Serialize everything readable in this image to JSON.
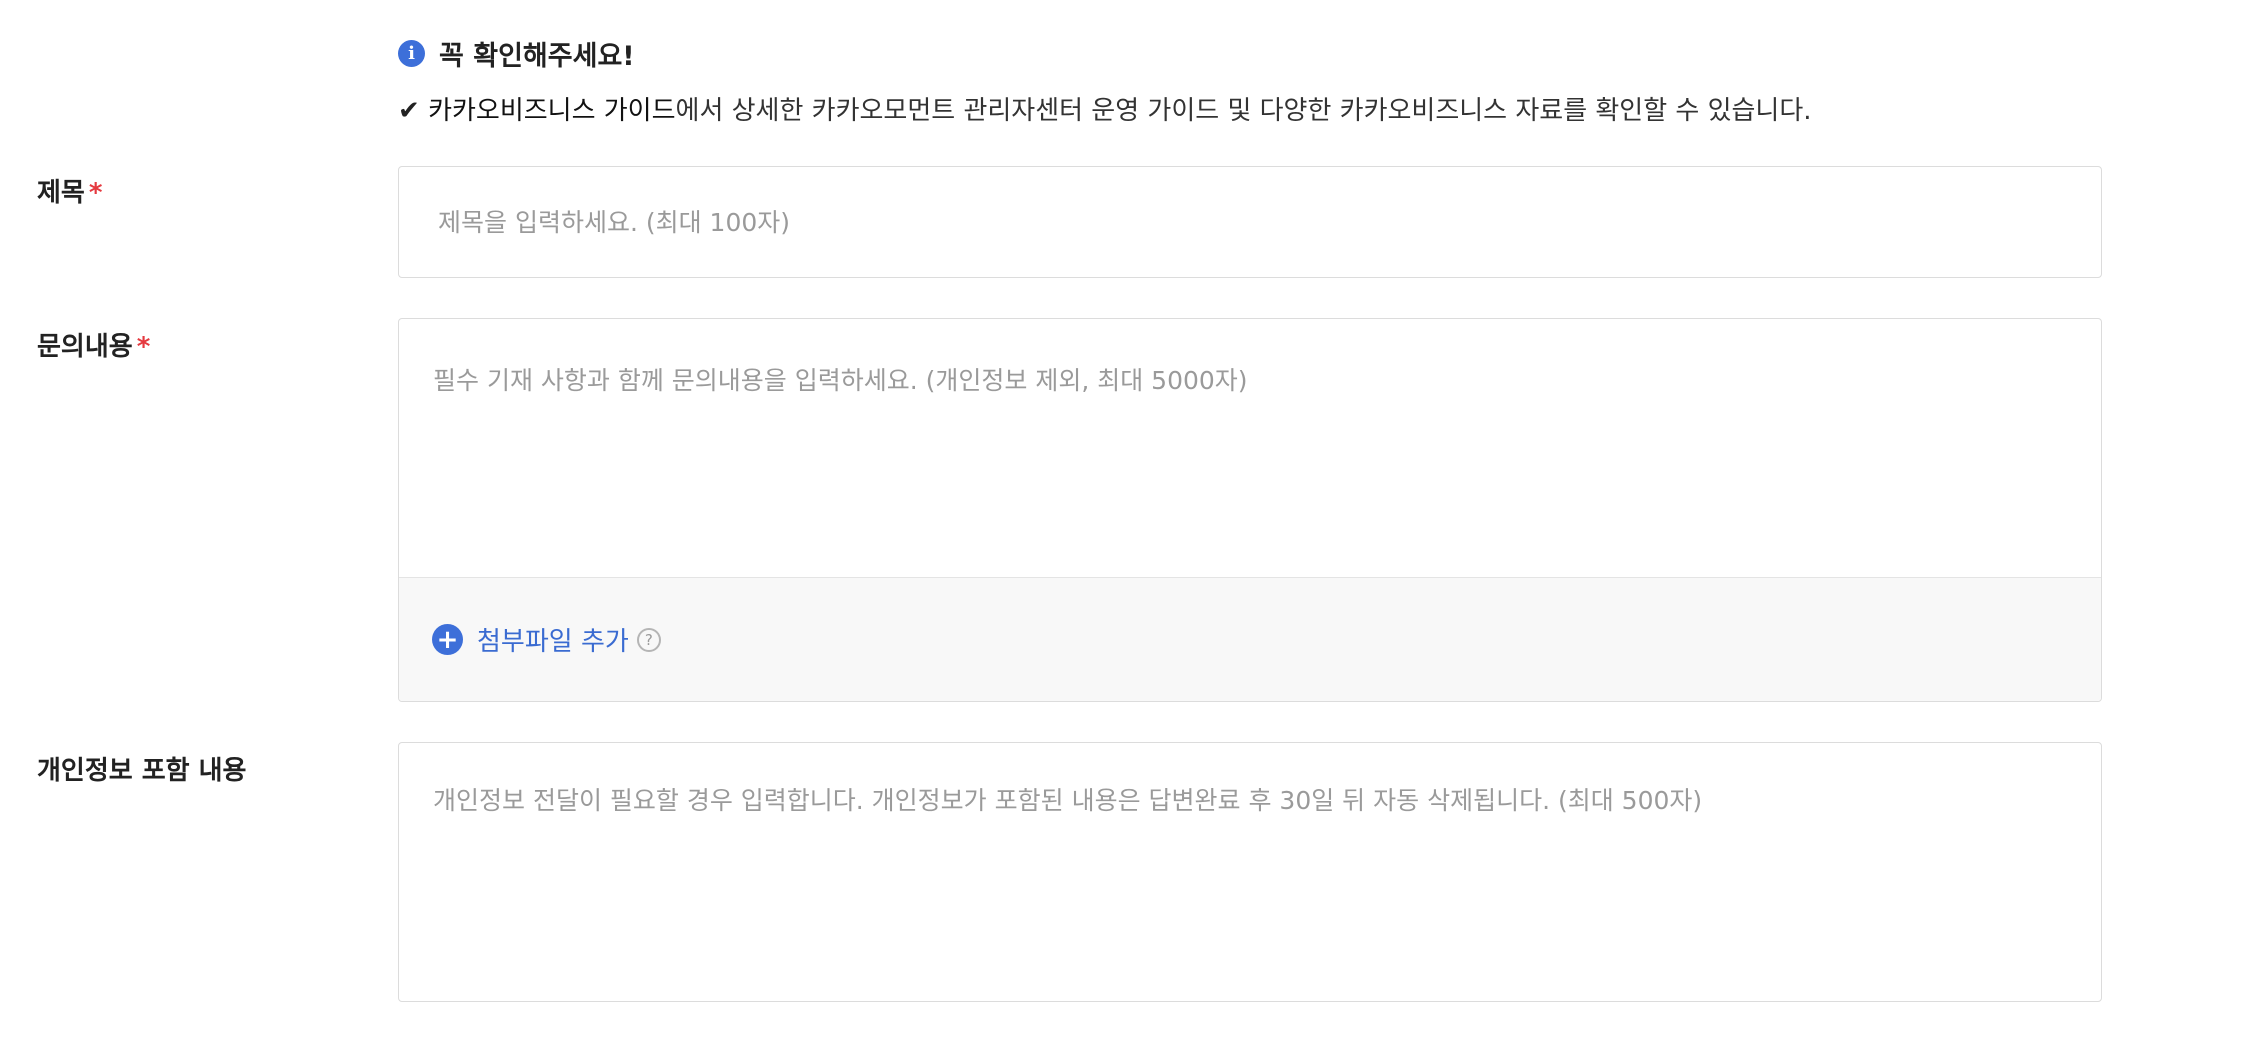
{
  "notice": {
    "title": "꼭 확인해주세요!",
    "check_mark": "✔",
    "guide_link": "카카오비즈니스 가이드",
    "text": "에서 상세한 카카오모먼트 관리자센터 운영 가이드 및 다양한 카카오비즈니스 자료를 확인할 수 있습니다."
  },
  "fields": {
    "title": {
      "label": "제목",
      "required_mark": "*",
      "placeholder": "제목을 입력하세요. (최대 100자)"
    },
    "content": {
      "label": "문의내용",
      "required_mark": "*",
      "placeholder": "필수 기재 사항과 함께 문의내용을 입력하세요. (개인정보 제외, 최대 5000자)",
      "attach_label": "첨부파일 추가"
    },
    "personal": {
      "label": "개인정보 포함 내용",
      "placeholder": "개인정보 전달이 필요할 경우 입력합니다. 개인정보가 포함된 내용은 답변완료 후 30일 뒤 자동 삭제됩니다. (최대 500자)"
    }
  },
  "colors": {
    "accent": "#3d6fd9",
    "required": "#e53a40",
    "link": "#3a6bd1"
  }
}
